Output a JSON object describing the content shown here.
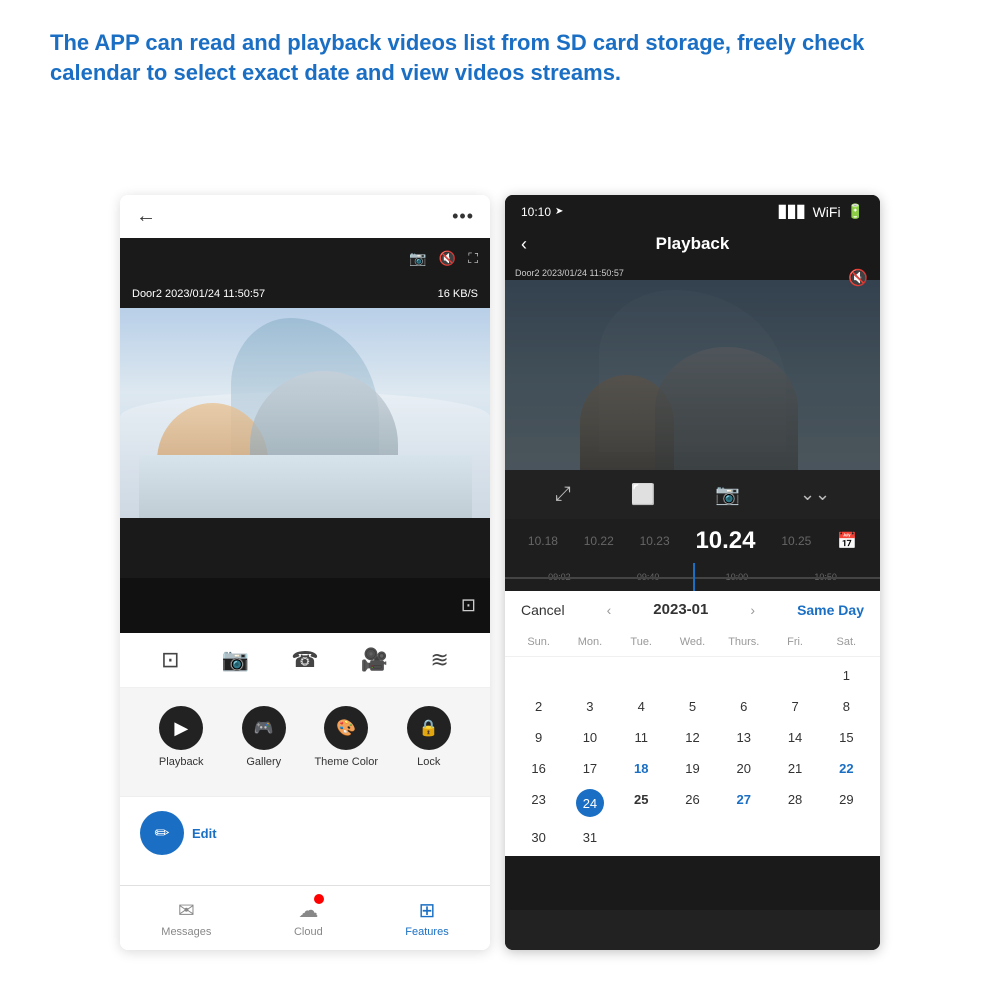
{
  "header": {
    "text": "The APP can read and playback videos list from SD card storage, freely check calendar to select exact date and view videos streams."
  },
  "phone_left": {
    "topbar": {
      "back_label": "←",
      "menu_label": "···"
    },
    "video": {
      "timestamp": "Door2 2023/01/24  11:50:57",
      "speed": "16 KB/S"
    },
    "toolbar_icons": [
      "frame",
      "camera",
      "phone",
      "video",
      "lines"
    ],
    "menu_items": [
      {
        "label": "Playback",
        "icon": "play"
      },
      {
        "label": "Gallery",
        "icon": "gallery"
      },
      {
        "label": "Theme Color",
        "icon": "theme"
      },
      {
        "label": "Lock",
        "icon": "lock"
      }
    ],
    "edit": {
      "label": "Edit"
    },
    "bottom_nav": [
      {
        "label": "Messages",
        "icon": "msg",
        "active": false
      },
      {
        "label": "Cloud",
        "icon": "cloud",
        "active": false
      },
      {
        "label": "Features",
        "icon": "features",
        "active": true
      }
    ]
  },
  "phone_right": {
    "status_bar": {
      "time": "10:10",
      "signal": "▲▲▲",
      "wifi": "WiFi",
      "battery": "🔋"
    },
    "title": "Playback",
    "video": {
      "timestamp": "Door2 2023/01/24  11:50:57"
    },
    "date_strip": {
      "dates": [
        "10.18",
        "10.22",
        "10.23",
        "10.24",
        "10.25"
      ],
      "active_index": 3
    },
    "timeline_labels": [
      "09:02",
      "09:40",
      "10:00",
      "10:50"
    ],
    "calendar": {
      "cancel_label": "Cancel",
      "month": "2023-01",
      "same_day_label": "Same Day",
      "day_headers": [
        "Sun.",
        "Mon.",
        "Tue.",
        "Wed.",
        "Thurs.",
        "Fri.",
        "Sat."
      ],
      "weeks": [
        [
          "",
          "",
          "",
          "",
          "",
          "",
          "1"
        ],
        [
          "2",
          "3",
          "4",
          "5",
          "6",
          "7",
          "8"
        ],
        [
          "9",
          "10",
          "11",
          "12",
          "13",
          "14",
          "15"
        ],
        [
          "16",
          "17",
          "18",
          "19",
          "20",
          "21",
          "22"
        ],
        [
          "23",
          "24",
          "25",
          "26",
          "27",
          "28",
          "29"
        ],
        [
          "30",
          "31",
          "",
          "",
          "",
          "",
          ""
        ]
      ],
      "today": "24",
      "highlighted": [
        "18",
        "22",
        "27"
      ],
      "bold": [
        "25"
      ]
    }
  }
}
